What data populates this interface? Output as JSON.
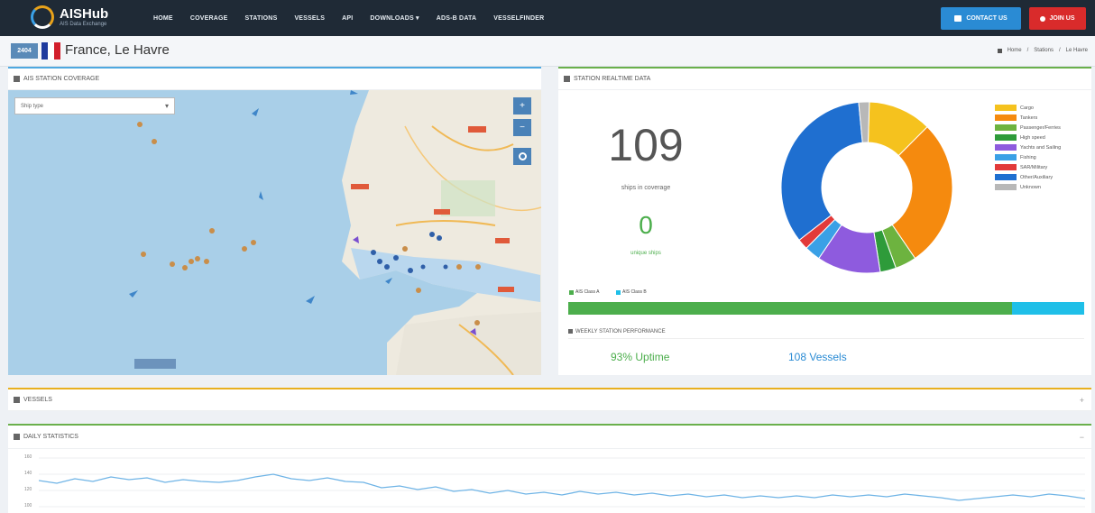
{
  "nav": {
    "brand": "AISHub",
    "brand_sub": "AIS Data Exchange",
    "items": [
      "HOME",
      "COVERAGE",
      "STATIONS",
      "VESSELS",
      "API",
      "DOWNLOADS ▾",
      "ADS-B DATA",
      "VESSELFINDER"
    ],
    "contact": "CONTACT US",
    "join": "JOIN US"
  },
  "station": {
    "id": "2404",
    "name": "France, Le Havre",
    "breadcrumb": [
      "Home",
      "Stations",
      "Le Havre"
    ],
    "flag_colors": [
      "#1e3a9e",
      "#ffffff",
      "#d21e2b"
    ]
  },
  "coverage": {
    "title": "AIS STATION COVERAGE",
    "select": "Ship type",
    "zoom_in": "+",
    "zoom_out": "−"
  },
  "realtime": {
    "title": "STATION REALTIME DATA",
    "ships": "109",
    "ships_label": "ships in coverage",
    "unique": "0",
    "unique_label": "unique ships",
    "class_a": "AIS Class A",
    "class_b": "AIS Class B",
    "class_a_fraction": 0.86
  },
  "chart_data": {
    "type": "pie",
    "donut": true,
    "categories": [
      "Cargo",
      "Tankers",
      "Passenger/Ferries",
      "High speed",
      "Yachts and Sailing",
      "Fishing",
      "SAR/Military",
      "Other/Auxiliary",
      "Unknown"
    ],
    "values": [
      12,
      28,
      4,
      3,
      12,
      3,
      2,
      34,
      2
    ],
    "colors": [
      "#f5c21e",
      "#f58a0e",
      "#6db33f",
      "#2e9b3a",
      "#8e5bde",
      "#3aa0e6",
      "#e23a3a",
      "#1f6fd0",
      "#b8b8b8"
    ]
  },
  "performance": {
    "title": "WEEKLY STATION PERFORMANCE",
    "uptime": "93% Uptime",
    "vessels": "108 Vessels"
  },
  "vessels_panel": {
    "title": "VESSELS"
  },
  "daily": {
    "title": "DAILY STATISTICS",
    "y_ticks": [
      "160",
      "140",
      "120",
      "100"
    ]
  }
}
